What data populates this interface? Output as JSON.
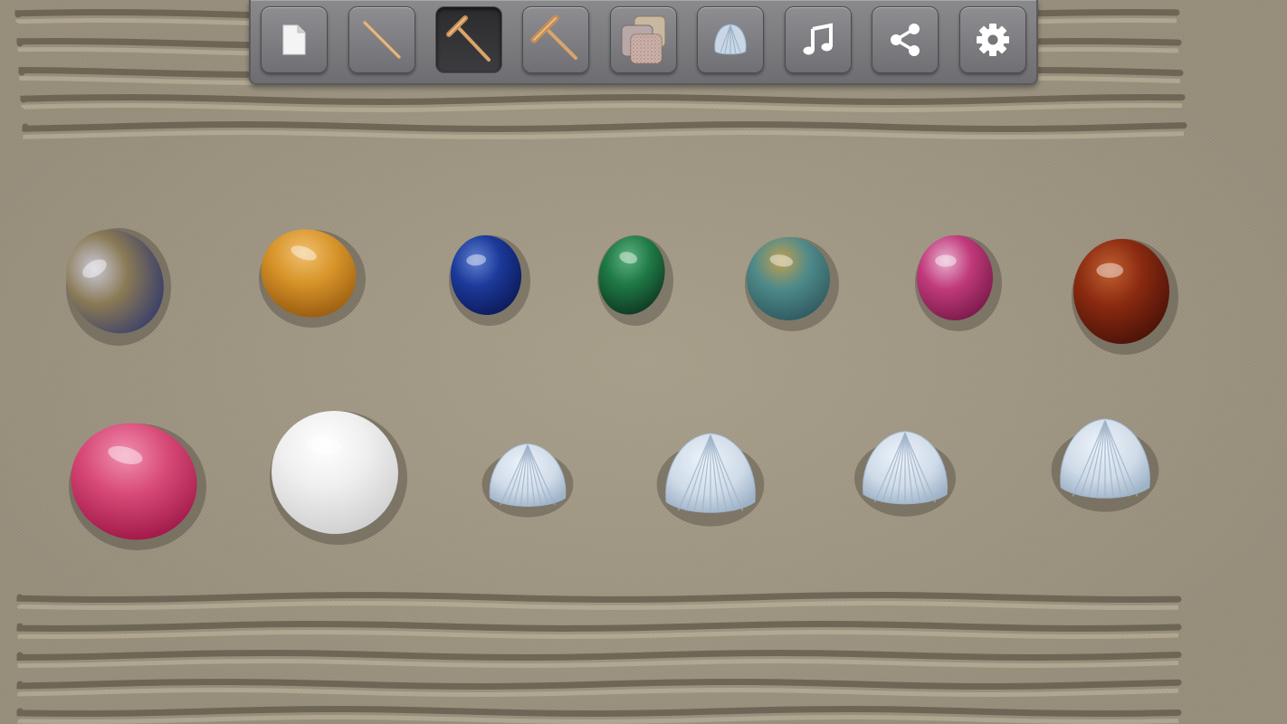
{
  "app": {
    "name": "Zen garden"
  },
  "toolbar": {
    "tools": [
      {
        "name": "new-file",
        "icon": "new-file-icon",
        "active": false
      },
      {
        "name": "line-stick",
        "icon": "stick-icon",
        "active": false
      },
      {
        "name": "rake",
        "icon": "rake-icon",
        "active": true
      },
      {
        "name": "wide-rake",
        "icon": "rake-wide-icon",
        "active": false
      },
      {
        "name": "sand-texture",
        "icon": "texture-icon",
        "active": false
      },
      {
        "name": "shell",
        "icon": "shell-icon",
        "active": false
      },
      {
        "name": "music",
        "icon": "music-note-icon",
        "active": false
      },
      {
        "name": "share",
        "icon": "share-icon",
        "active": false
      },
      {
        "name": "settings",
        "icon": "gear-icon",
        "active": false
      }
    ]
  },
  "garden": {
    "sand_color": "#a39a86",
    "stones_row_1": [
      {
        "kind": "agate",
        "colors": [
          "#3a3f6a",
          "#8a7a55",
          "#c9c9d8"
        ]
      },
      {
        "kind": "amber",
        "colors": [
          "#9a5c10",
          "#d8952a",
          "#f0c070"
        ]
      },
      {
        "kind": "lapis",
        "colors": [
          "#0c1a5a",
          "#1c3a9a",
          "#6080d0"
        ]
      },
      {
        "kind": "malachite",
        "colors": [
          "#0f3a22",
          "#1f7a46",
          "#60b080"
        ]
      },
      {
        "kind": "teal-agate",
        "colors": [
          "#2f5a60",
          "#4f8a8a",
          "#c0a050"
        ]
      },
      {
        "kind": "pink-agate",
        "colors": [
          "#7a1a4a",
          "#c03a7a",
          "#e8b0d0"
        ]
      },
      {
        "kind": "goldstone",
        "colors": [
          "#4a1208",
          "#8a2a10",
          "#c06030"
        ]
      }
    ],
    "stones_row_2": [
      {
        "kind": "rose-quartz",
        "colors": [
          "#a01848",
          "#d84a78",
          "#f090b0"
        ]
      },
      {
        "kind": "clear-quartz",
        "colors": [
          "#cfcfcf",
          "#efefef",
          "#ffffff"
        ]
      },
      {
        "kind": "shell",
        "colors": [
          "#9fb3c8",
          "#cfdbe8",
          "#eef4fb"
        ]
      },
      {
        "kind": "shell",
        "colors": [
          "#9fb3c8",
          "#cfdbe8",
          "#eef4fb"
        ]
      },
      {
        "kind": "shell",
        "colors": [
          "#9fb3c8",
          "#cfdbe8",
          "#eef4fb"
        ]
      },
      {
        "kind": "shell",
        "colors": [
          "#9fb3c8",
          "#cfdbe8",
          "#eef4fb"
        ]
      }
    ]
  }
}
